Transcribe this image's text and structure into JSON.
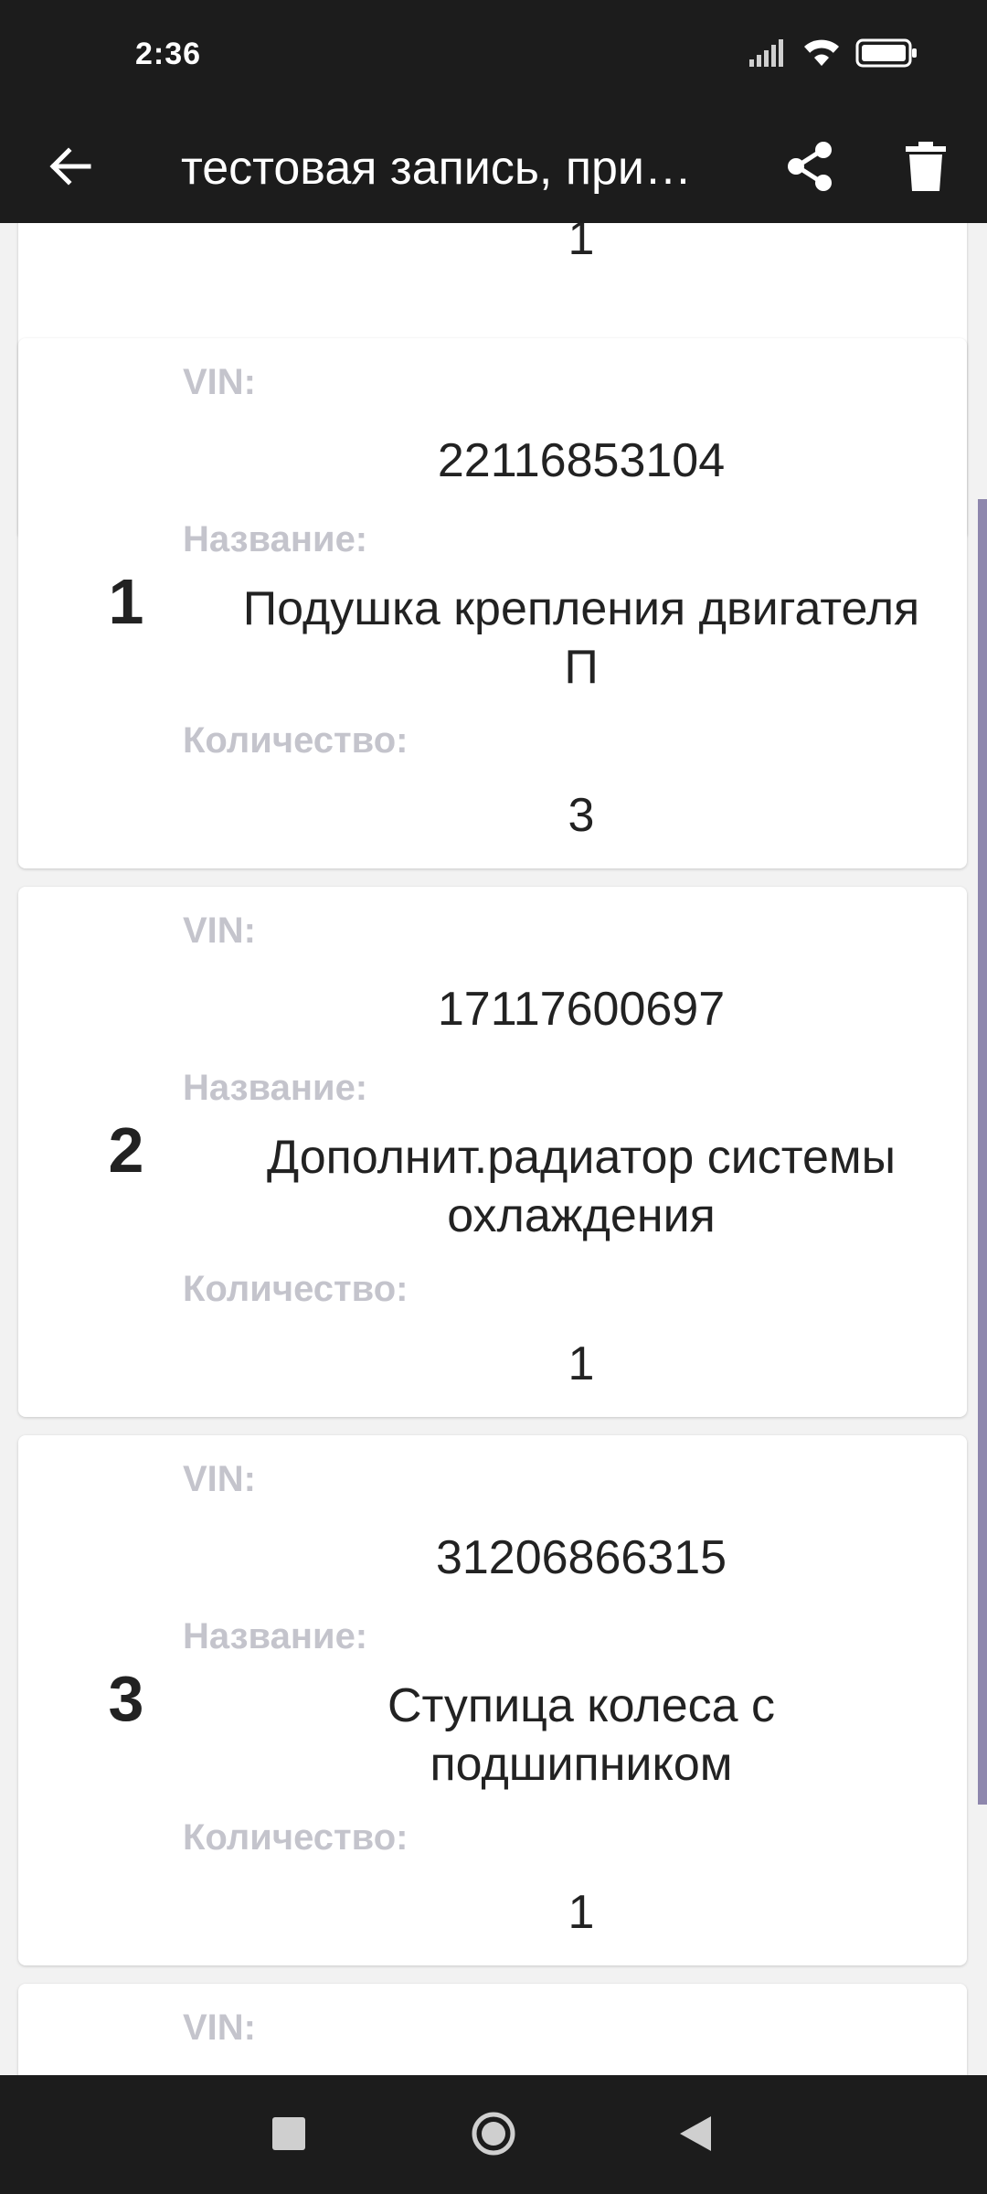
{
  "status_bar": {
    "time": "2:36"
  },
  "app_bar": {
    "title": "тестовая запись, при…",
    "back_icon": "arrow-left-icon",
    "share_icon": "share-icon",
    "delete_icon": "trash-icon"
  },
  "partial_top": {
    "quantity": "1"
  },
  "items": [
    {
      "index": "1",
      "vin_label": "VIN:",
      "vin": "22116853104",
      "name_label": "Название:",
      "name": "Подушка крепления двигателя П",
      "qty_label": "Количество:",
      "qty": "3"
    },
    {
      "index": "2",
      "vin_label": "VIN:",
      "vin": "17117600697",
      "name_label": "Название:",
      "name": "Дополнит.радиатор системы охлаждения",
      "qty_label": "Количество:",
      "qty": "1"
    },
    {
      "index": "3",
      "vin_label": "VIN:",
      "vin": "31206866315",
      "name_label": "Название:",
      "name": "Ступица колеса с подшипником",
      "qty_label": "Количество:",
      "qty": "1"
    }
  ],
  "partial_bottom": {
    "vin_label": "VIN:"
  },
  "colors": {
    "app_bar": "#1c1c1c",
    "label": "#c4c4cc",
    "scroll_thumb": "#8e87ad"
  }
}
